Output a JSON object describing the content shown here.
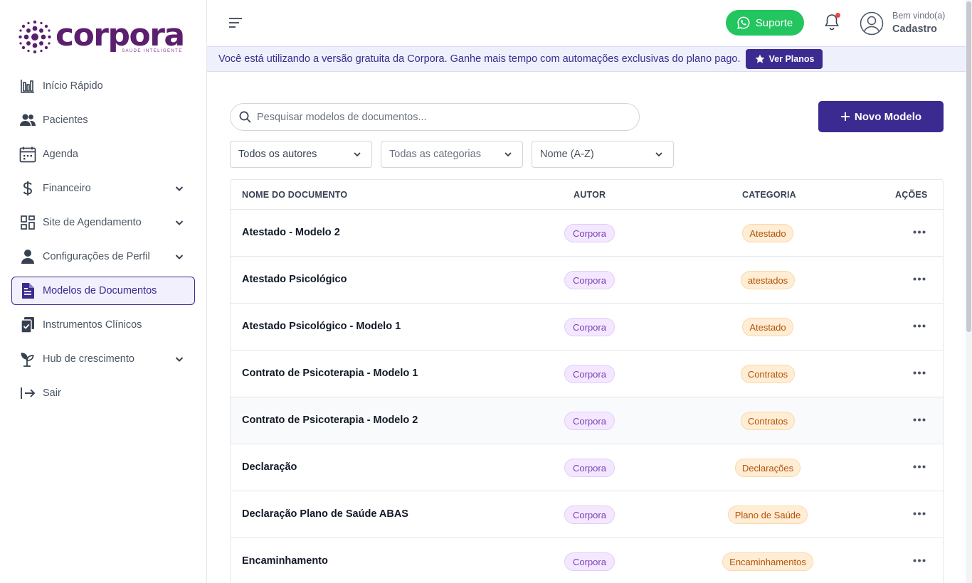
{
  "brand": {
    "name": "corpora",
    "tagline": "SAÚDE INTELIGENTE",
    "color": "#5b1f6e"
  },
  "sidebar": {
    "items": [
      {
        "label": "Início Rápido",
        "icon": "bar-chart-icon",
        "has_chevron": false,
        "active": false
      },
      {
        "label": "Pacientes",
        "icon": "users-icon",
        "has_chevron": false,
        "active": false
      },
      {
        "label": "Agenda",
        "icon": "calendar-icon",
        "has_chevron": false,
        "active": false
      },
      {
        "label": "Financeiro",
        "icon": "dollar-icon",
        "has_chevron": true,
        "active": false
      },
      {
        "label": "Site de Agendamento",
        "icon": "grid-icon",
        "has_chevron": true,
        "active": false
      },
      {
        "label": "Configurações de Perfil",
        "icon": "user-icon",
        "has_chevron": true,
        "active": false
      },
      {
        "label": "Modelos de Documentos",
        "icon": "document-icon",
        "has_chevron": false,
        "active": true
      },
      {
        "label": "Instrumentos Clínicos",
        "icon": "clipboard-icon",
        "has_chevron": false,
        "active": false
      },
      {
        "label": "Hub de crescimento",
        "icon": "sprout-icon",
        "has_chevron": true,
        "active": false
      },
      {
        "label": "Sair",
        "icon": "logout-icon",
        "has_chevron": false,
        "active": false
      }
    ]
  },
  "header": {
    "support_label": "Suporte",
    "notification_indicator": true,
    "greeting": "Bem vindo(a)",
    "user_name": "Cadastro"
  },
  "banner": {
    "text": "Você está utilizando a versão gratuita da Corpora. Ganhe mais tempo com automações exclusivas do plano pago.",
    "button_label": "Ver Planos"
  },
  "toolbar": {
    "search_placeholder": "Pesquisar modelos de documentos...",
    "new_button_label": "Novo Modelo"
  },
  "filters": {
    "author": "Todos os autores",
    "category": "Todas as categorias",
    "sort": "Nome (A-Z)"
  },
  "table": {
    "columns": {
      "name": "NOME DO DOCUMENTO",
      "author": "AUTOR",
      "category": "CATEGORIA",
      "actions": "AÇÕES"
    },
    "rows": [
      {
        "name": "Atestado - Modelo 2",
        "author": "Corpora",
        "category": "Atestado"
      },
      {
        "name": "Atestado Psicológico",
        "author": "Corpora",
        "category": "atestados"
      },
      {
        "name": "Atestado Psicológico - Modelo 1",
        "author": "Corpora",
        "category": "Atestado"
      },
      {
        "name": "Contrato de Psicoterapia - Modelo 1",
        "author": "Corpora",
        "category": "Contratos"
      },
      {
        "name": "Contrato de Psicoterapia - Modelo 2",
        "author": "Corpora",
        "category": "Contratos"
      },
      {
        "name": "Declaração",
        "author": "Corpora",
        "category": "Declarações"
      },
      {
        "name": "Declaração Plano de Saúde ABAS",
        "author": "Corpora",
        "category": "Plano de Saúde"
      },
      {
        "name": "Encaminhamento",
        "author": "Corpora",
        "category": "Encaminhamentos"
      }
    ],
    "hovered_row": 4
  },
  "colors": {
    "primary": "#3b2b91",
    "support_green": "#22c55e",
    "author_badge_bg": "#f3e8ff",
    "category_badge_bg": "#ffedd5",
    "notification_dot": "#ef4444"
  }
}
